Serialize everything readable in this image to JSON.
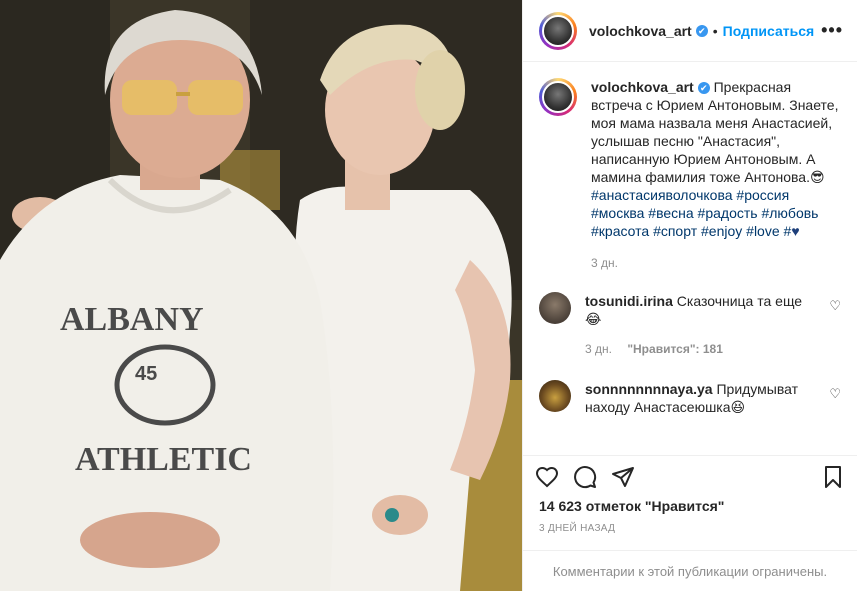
{
  "post": {
    "username": "volochkova_art",
    "verified_mark": "✔",
    "separator": "•",
    "follow_label": "Подписаться",
    "more_label": "•••"
  },
  "caption": {
    "username": "volochkova_art",
    "text": "Прекрасная встреча с Юрием Антоновым. Знаете, моя мама назвала меня Анастасией, услышав песню \"Анастасия\", написанную Юрием Антоновым. А мамина фамилия тоже Антонова.",
    "emoji": "😎",
    "hashtags": [
      "#анастасияволочкова",
      "#россия",
      "#москва",
      "#весна",
      "#радость",
      "#любовь",
      "#красота",
      "#спорт",
      "#enjoy",
      "#love",
      "#"
    ],
    "heart": "♥",
    "time": "3 дн."
  },
  "comments": [
    {
      "username": "tosunidi.irina",
      "text": "Сказочница та еще",
      "emoji": "😂",
      "time": "3 дн.",
      "likes": "\"Нравится\": 181"
    },
    {
      "username": "sonnnnnnnnaya.ya",
      "text": "Придумыват находу Анастасеюшка",
      "emoji": "😆",
      "time": "",
      "likes": ""
    }
  ],
  "likes_count": "14 623 отметок \"Нравится\"",
  "post_age": "3 ДНЕЙ НАЗАД",
  "comments_restricted": "Комментарии к этой публикации ограничены.",
  "icons": [
    "heart-icon",
    "comment-icon",
    "share-icon",
    "bookmark-icon"
  ],
  "colors": {
    "link": "#0095f6",
    "hashtag": "#00376b",
    "muted": "#8e8e8e",
    "verified": "#3897f0"
  }
}
